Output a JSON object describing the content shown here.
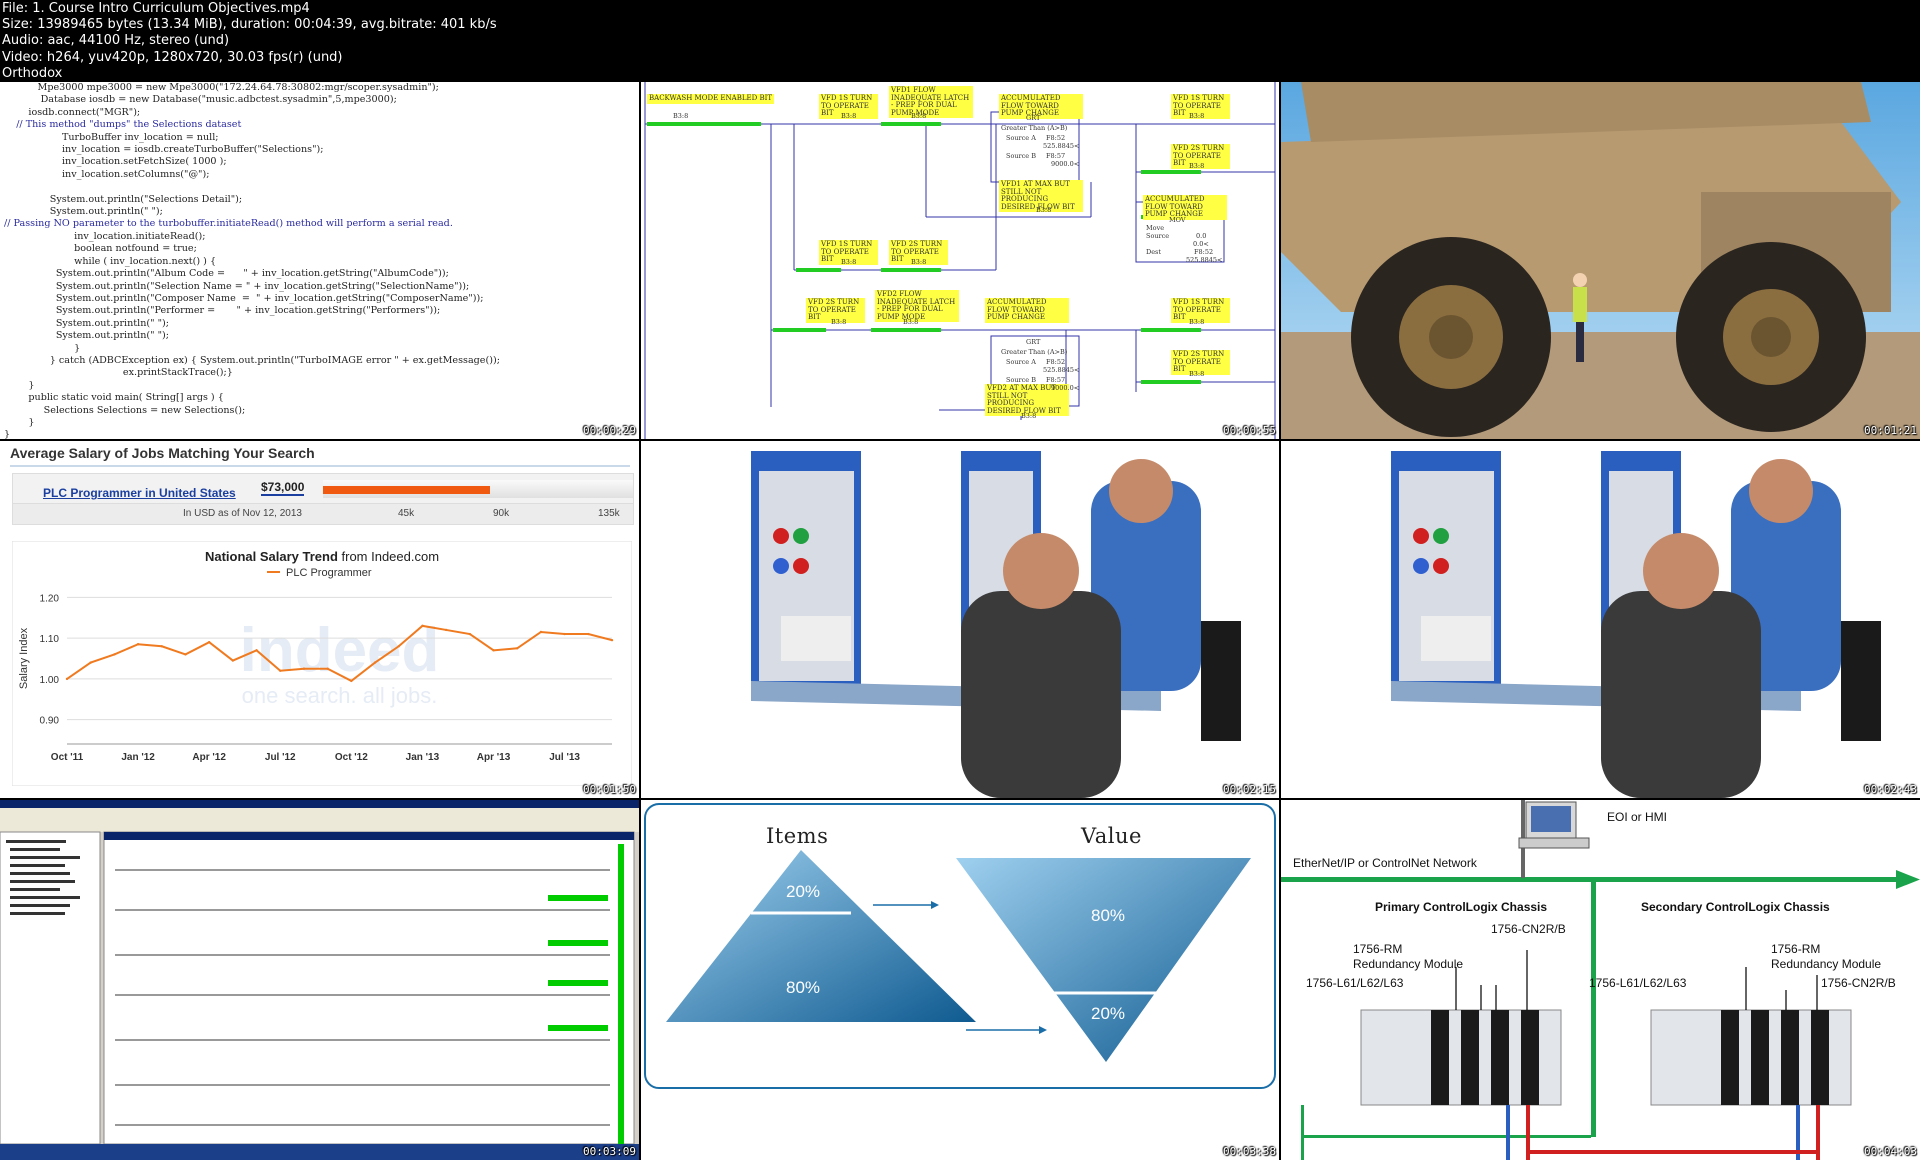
{
  "header": {
    "line1": "File: 1. Course Intro Curriculum  Objectives.mp4",
    "line2": "Size: 13989465 bytes (13.34 MiB), duration: 00:04:39, avg.bitrate: 401 kb/s",
    "line3": "Audio: aac, 44100 Hz, stereo (und)",
    "line4": "Video: h264, yuv420p, 1280x720, 30.03 fps(r) (und)",
    "line5": "Orthodox"
  },
  "timestamps": [
    "00:00:29",
    "00:00:55",
    "00:01:21",
    "00:01:50",
    "00:02:15",
    "00:02:43",
    "00:03:09",
    "00:03:38",
    "00:04:03"
  ],
  "code": {
    "lines": [
      "           Mpe3000 mpe3000 = new Mpe3000(\"172.24.64.78:30802:mgr/scoper.sysadmin\");",
      "            Database iosdb = new Database(\"music.adbctest.sysadmin\",5,mpe3000);",
      "        iosdb.connect(\"MGR\");",
      "    // This method \"dumps\" the Selections dataset",
      "                   TurboBuffer inv_location = null;",
      "                   inv_location = iosdb.createTurboBuffer(\"Selections\");",
      "                   inv_location.setFetchSize( 1000 );",
      "                   inv_location.setColumns(\"@\");",
      "",
      "               System.out.println(\"Selections Detail\");",
      "               System.out.println(\" \");",
      "// Passing NO parameter to the turbobuffer.initiateRead() method will perform a serial read.",
      "                       inv_location.initiateRead();",
      "                       boolean notfound = true;",
      "                       while ( inv_location.next() ) {",
      "                 System.out.println(\"Album Code =      \" + inv_location.getString(\"AlbumCode\"));",
      "                 System.out.println(\"Selection Name = \" + inv_location.getString(\"SelectionName\"));",
      "                 System.out.println(\"Composer Name  =  \" + inv_location.getString(\"ComposerName\"));",
      "                 System.out.println(\"Performer =       \" + inv_location.getString(\"Performers\"));",
      "                 System.out.println(\" \");",
      "                 System.out.println(\" \");",
      "                       }",
      "               } catch (ADBCException ex) { System.out.println(\"TurboIMAGE error \" + ex.getMessage());",
      "                                       ex.printStackTrace();}",
      "        }",
      "        public static void main( String[] args ) {",
      "             Selections Selections = new Selections();",
      "        }",
      "}"
    ]
  },
  "ladder": {
    "labels": [
      "BACKWASH MODE ENABLED BIT",
      "VFD 1S TURN TO OPERATE BIT",
      "VFD1 FLOW INADEQUATE LATCH - PREP FOR DUAL PUMP MODE",
      "ACCUMULATED FLOW TOWARD PUMP CHANGE",
      "VFD 1S TURN TO OPERATE BIT",
      "VFD 2S TURN TO OPERATE BIT",
      "VFD1 AT MAX BUT STILL NOT PRODUCING DESIRED FLOW BIT",
      "ACCUMULATED FLOW TOWARD PUMP CHANGE",
      "VFD 1S TURN TO OPERATE BIT",
      "VFD 2S TURN TO OPERATE BIT",
      "VFD 2S TURN TO OPERATE BIT",
      "VFD2 FLOW INADEQUATE LATCH - PREP FOR DUAL PUMP MODE",
      "ACCUMULATED FLOW TOWARD PUMP CHANGE",
      "VFD 1S TURN TO OPERATE BIT",
      "VFD 2S TURN TO OPERATE BIT",
      "VFD2 AT MAX BUT STILL NOT PRODUCING DESIRED FLOW BIT"
    ],
    "bit": "B3:8",
    "grt": "GRT",
    "grt_text": "Greater Than (A>B)",
    "source_a": "Source A",
    "source_b": "Source B",
    "val_a": "F8:52",
    "val_a2": "525.8845<",
    "val_b": "F8:57",
    "val_b2": "9000.0<",
    "mov": "MOV",
    "mov_text": "Move",
    "source": "Source",
    "src_val": "0.0",
    "src_val2": "0.0<",
    "dest": "Dest",
    "dest_val": "F8:52",
    "dest_val2": "525.8845<"
  },
  "salary": {
    "title": "Average Salary of Jobs Matching Your Search",
    "job_link": "PLC Programmer in United States",
    "amount": "$73,000",
    "asof": "In USD as of Nov 12, 2013",
    "scale": [
      "45k",
      "90k",
      "135k"
    ],
    "chart_title_bold": "National Salary Trend",
    "chart_title_rest": "from Indeed.com",
    "legend": "PLC Programmer",
    "watermark": "indeed",
    "watermark_tag": "one search. all jobs."
  },
  "chart_data": {
    "type": "line",
    "title": "National Salary Trend from Indeed.com",
    "ylabel": "Salary Index",
    "xlabel": "",
    "x": [
      "Oct '11",
      "Nov '11",
      "Dec '11",
      "Jan '12",
      "Feb '12",
      "Mar '12",
      "Apr '12",
      "May '12",
      "Jun '12",
      "Jul '12",
      "Aug '12",
      "Sep '12",
      "Oct '12",
      "Nov '12",
      "Dec '12",
      "Jan '13",
      "Feb '13",
      "Mar '13",
      "Apr '13",
      "May '13",
      "Jun '13",
      "Jul '13",
      "Aug '13",
      "Sep '13"
    ],
    "xticks": [
      "Oct '11",
      "Jan '12",
      "Apr '12",
      "Jul '12",
      "Oct '12",
      "Jan '13",
      "Apr '13",
      "Jul '13"
    ],
    "yticks": [
      "1.20",
      "1.10",
      "1.00",
      "0.90"
    ],
    "ylim": [
      0.86,
      1.24
    ],
    "series": [
      {
        "name": "PLC Programmer",
        "color": "#f07a1f",
        "values": [
          1.0,
          1.04,
          1.06,
          1.085,
          1.08,
          1.06,
          1.09,
          1.045,
          1.07,
          1.02,
          1.025,
          1.025,
          0.995,
          1.04,
          1.08,
          1.13,
          1.12,
          1.11,
          1.07,
          1.075,
          1.115,
          1.11,
          1.11,
          1.095
        ]
      }
    ]
  },
  "pyramid": {
    "items_title": "Items",
    "value_title": "Value",
    "items_top": "20%",
    "items_bottom": "80%",
    "value_top": "80%",
    "value_bottom": "20%"
  },
  "network": {
    "hmi": "EOI or HMI",
    "net": "EtherNet/IP or ControlNet Network",
    "primary": "Primary ControlLogix Chassis",
    "secondary": "Secondary ControlLogix Chassis",
    "cn2r": "1756-CN2R/B",
    "rm": "1756-RM",
    "rm2": "Redundancy Module",
    "l6x": "1756-L61/L62/L63"
  },
  "colors": {
    "orange": "#f07a1f",
    "ladder_green": "#22cc22",
    "label_yellow": "#ffff44",
    "net_green": "#1aa34a",
    "pyramid_blue": "#1a6ea8"
  }
}
